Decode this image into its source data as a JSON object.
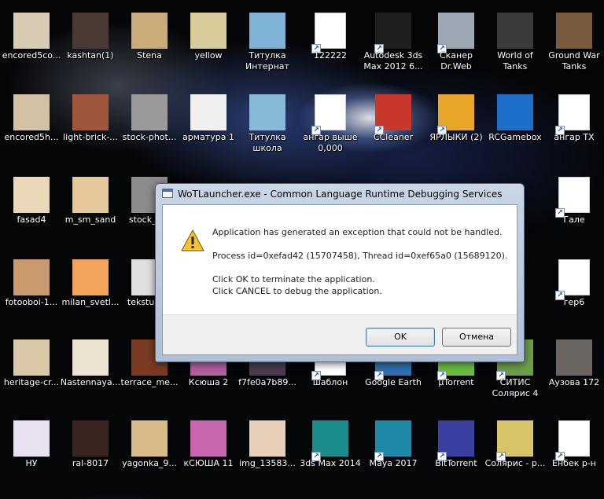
{
  "desktop": {
    "icons": [
      {
        "label": [
          "encored5co..."
        ],
        "thumb": "#d8cbb3",
        "shortcut": false
      },
      {
        "label": [
          "kashtan(1)"
        ],
        "thumb": "#4b3a33",
        "shortcut": false
      },
      {
        "label": [
          "Stena"
        ],
        "thumb": "#c9ac7a",
        "shortcut": false
      },
      {
        "label": [
          "yellow"
        ],
        "thumb": "#d8cc9a",
        "shortcut": false
      },
      {
        "label": [
          "Титулка",
          "Интернат"
        ],
        "thumb": "#7fb3d5",
        "shortcut": false
      },
      {
        "label": [
          "122222"
        ],
        "thumb": "#ffffff",
        "shortcut": true
      },
      {
        "label": [
          "Autodesk 3ds",
          "Max 2012 6..."
        ],
        "thumb": "#1f1f1f",
        "shortcut": true
      },
      {
        "label": [
          "Сканер",
          "Dr.Web"
        ],
        "thumb": "#9ea8b5",
        "shortcut": true
      },
      {
        "label": [
          "World of",
          "Tanks"
        ],
        "thumb": "#3a3a3a",
        "shortcut": false
      },
      {
        "label": [
          "Ground War",
          "Tanks"
        ],
        "thumb": "#7a5a3e",
        "shortcut": false
      },
      {
        "label": [
          "encored5h..."
        ],
        "thumb": "#d2c1a3",
        "shortcut": false
      },
      {
        "label": [
          "light-brick-..."
        ],
        "thumb": "#a0563a",
        "shortcut": false
      },
      {
        "label": [
          "stock-phot..."
        ],
        "thumb": "#9a9a9a",
        "shortcut": false
      },
      {
        "label": [
          "арматура 1"
        ],
        "thumb": "#f0f0f0",
        "shortcut": false
      },
      {
        "label": [
          "Титулка",
          "школа"
        ],
        "thumb": "#86b9d8",
        "shortcut": false
      },
      {
        "label": [
          "ангар выше",
          "0,000"
        ],
        "thumb": "#ffffff",
        "shortcut": true
      },
      {
        "label": [
          "CCleaner"
        ],
        "thumb": "#c8362c",
        "shortcut": true
      },
      {
        "label": [
          "ЯРЛЫКИ (2)"
        ],
        "thumb": "#e8a628",
        "shortcut": true
      },
      {
        "label": [
          "RCGamebox"
        ],
        "thumb": "#1d6fc7",
        "shortcut": false
      },
      {
        "label": [
          "ангар TX"
        ],
        "thumb": "#ffffff",
        "shortcut": true
      },
      {
        "label": [
          "fasad4"
        ],
        "thumb": "#e9d7b8",
        "shortcut": false
      },
      {
        "label": [
          "m_sm_sand"
        ],
        "thumb": "#e4c79b",
        "shortcut": false
      },
      {
        "label": [
          "stock_p..."
        ],
        "thumb": "#8c8c8c",
        "shortcut": false
      },
      {
        "label": [
          "Гале"
        ],
        "thumb": "#ffffff",
        "shortcut": true
      },
      {
        "label": [
          "fotooboi-1..."
        ],
        "thumb": "#c99a6d",
        "shortcut": false
      },
      {
        "label": [
          "milan_svetl..."
        ],
        "thumb": "#f2a35c",
        "shortcut": false
      },
      {
        "label": [
          "tekstura..."
        ],
        "thumb": "#e0e0e0",
        "shortcut": false
      },
      {
        "label": [
          "гер6"
        ],
        "thumb": "#ffffff",
        "shortcut": true
      },
      {
        "label": [
          "heritage-cr..."
        ],
        "thumb": "#d9c7a8",
        "shortcut": false
      },
      {
        "label": [
          "Nastennaya..."
        ],
        "thumb": "#ede3d2",
        "shortcut": false
      },
      {
        "label": [
          "terrace_me..."
        ],
        "thumb": "#7a3b22",
        "shortcut": false
      },
      {
        "label": [
          "Ксюша 2"
        ],
        "thumb": "#b05fa0",
        "shortcut": false
      },
      {
        "label": [
          "f7fe0a7b89..."
        ],
        "thumb": "#4a3b52",
        "shortcut": false
      },
      {
        "label": [
          "шаблон"
        ],
        "thumb": "#ffffff",
        "shortcut": true
      },
      {
        "label": [
          "Google Earth"
        ],
        "thumb": "#2c6fb0",
        "shortcut": true
      },
      {
        "label": [
          "µTorrent"
        ],
        "thumb": "#6bbf3f",
        "shortcut": true
      },
      {
        "label": [
          "СИТИС",
          "Солярис 4"
        ],
        "thumb": "#6c9e4a",
        "shortcut": true
      },
      {
        "label": [
          "Аузова 172"
        ],
        "thumb": "#6a6560",
        "shortcut": false
      },
      {
        "label": [
          "НУ"
        ],
        "thumb": "#e8e1f0",
        "shortcut": false
      },
      {
        "label": [
          "ral-8017"
        ],
        "thumb": "#3a2420",
        "shortcut": false
      },
      {
        "label": [
          "yagonka_9..."
        ],
        "thumb": "#d8b98a",
        "shortcut": false
      },
      {
        "label": [
          "кСЮША 11"
        ],
        "thumb": "#c866b0",
        "shortcut": false
      },
      {
        "label": [
          "img_13583..."
        ],
        "thumb": "#e6d0b8",
        "shortcut": false
      },
      {
        "label": [
          "3ds Max 2014"
        ],
        "thumb": "#1a8c8c",
        "shortcut": true
      },
      {
        "label": [
          "Maya 2017"
        ],
        "thumb": "#1f8aa8",
        "shortcut": true
      },
      {
        "label": [
          "BitTorrent"
        ],
        "thumb": "#3a3fa0",
        "shortcut": true
      },
      {
        "label": [
          "Солярис - р..."
        ],
        "thumb": "#d8c468",
        "shortcut": true
      },
      {
        "label": [
          "Енбек р-н"
        ],
        "thumb": "#ffffff",
        "shortcut": true
      }
    ]
  },
  "dialog": {
    "title": "WoTLauncher.exe - Common Language Runtime Debugging Services",
    "line1": "Application has generated an exception that could not be handled.",
    "line2": "Process id=0xefad42 (15707458), Thread id=0xef65a0 (15689120).",
    "line3": "Click OK to terminate the application.",
    "line4": "Click CANCEL to debug the application.",
    "ok_label": "OK",
    "cancel_label": "Отмена",
    "icon": "warning-icon"
  }
}
